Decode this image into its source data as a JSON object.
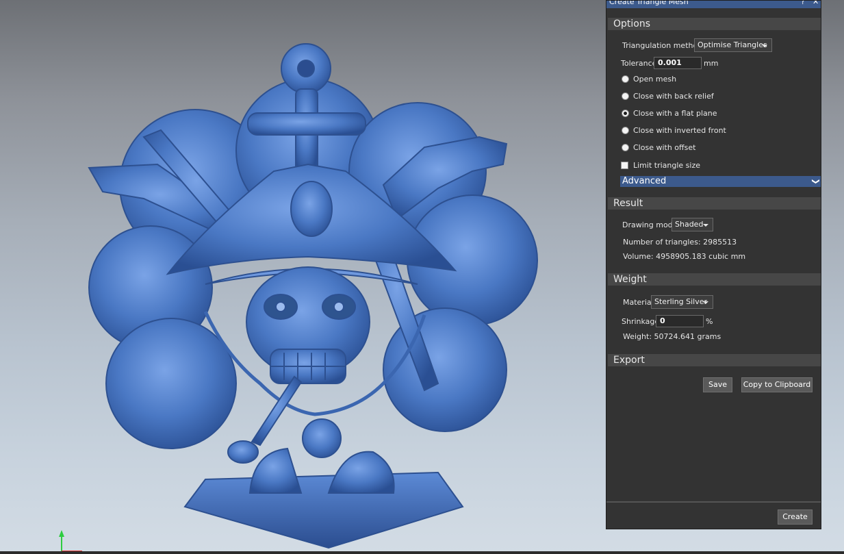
{
  "dialog": {
    "title": "Create Triangle Mesh",
    "help_glyph": "?",
    "close_glyph": "✕"
  },
  "options": {
    "header": "Options",
    "triangulation_label": "Triangulation method",
    "triangulation_value": "Optimise Triangles",
    "tolerance_label": "Tolerance",
    "tolerance_value": "0.001",
    "tolerance_unit": "mm",
    "radios": [
      {
        "label": "Open mesh",
        "selected": false
      },
      {
        "label": "Close with back relief",
        "selected": false
      },
      {
        "label": "Close with a flat plane",
        "selected": true
      },
      {
        "label": "Close with inverted front",
        "selected": false
      },
      {
        "label": "Close with offset",
        "selected": false
      }
    ],
    "limit_label": "Limit triangle size",
    "limit_checked": false,
    "advanced_label": "Advanced",
    "advanced_chevron": "❯"
  },
  "result": {
    "header": "Result",
    "drawing_mode_label": "Drawing mode",
    "drawing_mode_value": "Shaded",
    "triangles_text": "Number of triangles: 2985513",
    "volume_text": "Volume: 4958905.183 cubic mm"
  },
  "weight": {
    "header": "Weight",
    "material_label": "Material",
    "material_value": "Sterling Silver",
    "shrinkage_label": "Shrinkage",
    "shrinkage_value": "0",
    "shrinkage_unit": "%",
    "weight_text": "Weight: 50724.641 grams"
  },
  "export": {
    "header": "Export",
    "save_label": "Save",
    "copy_label": "Copy to Clipboard"
  },
  "footer": {
    "create_label": "Create"
  },
  "colors": {
    "accent": "#3c5a8c",
    "panel_bg": "#333333",
    "model_blue": "#4a78c4"
  }
}
